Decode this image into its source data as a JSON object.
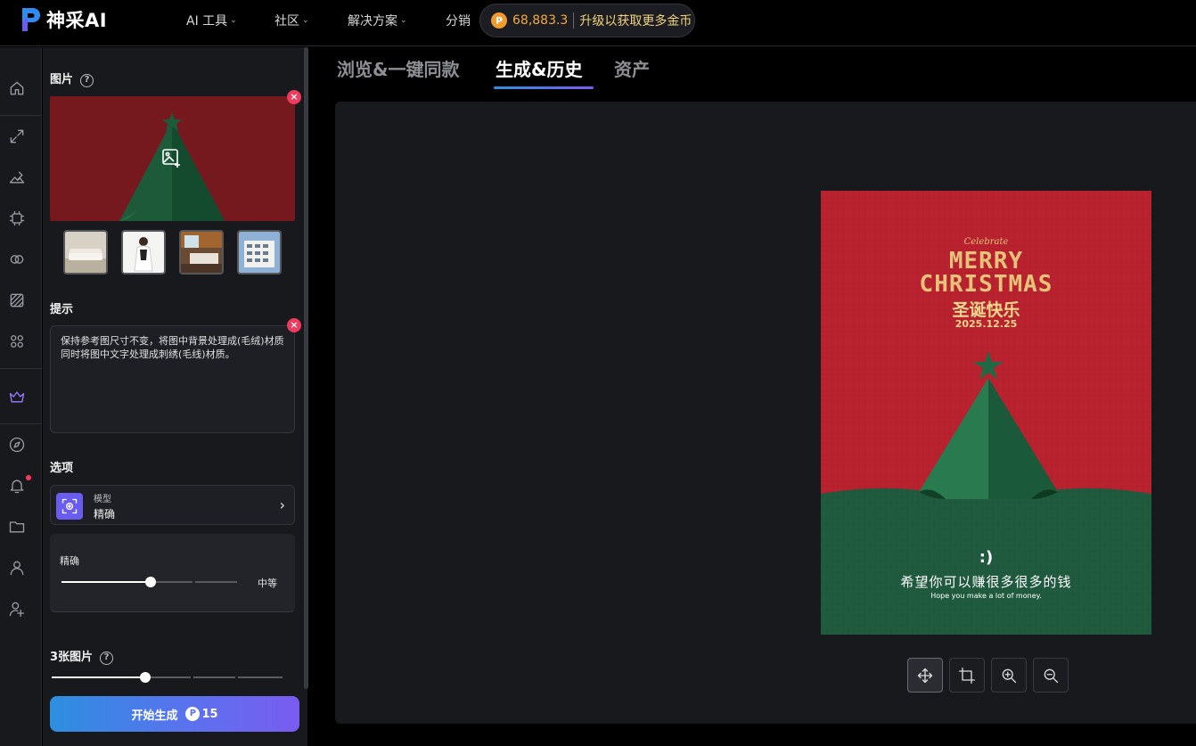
{
  "brand": {
    "name": "神采AI"
  },
  "nav": {
    "items": [
      {
        "label": "AI 工具",
        "has_menu": true
      },
      {
        "label": "社区",
        "has_menu": true
      },
      {
        "label": "解决方案",
        "has_menu": true
      },
      {
        "label": "分销",
        "has_menu": false
      }
    ],
    "coins": {
      "amount": "68,883.3",
      "upgrade": "升级以获取更多金币"
    }
  },
  "rail": {
    "icons": [
      "home-icon",
      "expand-icon",
      "edit-image-icon",
      "chip-icon",
      "link-icon",
      "texture-icon",
      "apps-icon",
      "crown-icon",
      "compass-icon",
      "bell-icon",
      "folder-icon",
      "user-icon",
      "user-settings-icon"
    ],
    "active": "crown-icon",
    "notification_dot": "bell-icon",
    "colors": {
      "active": "#9b7bff",
      "default": "#9a9ca3"
    }
  },
  "panel": {
    "image_section": {
      "title": "图片",
      "reference_thumbnails": [
        "sofa-thumbnail",
        "woman-in-white-thumbnail",
        "bedroom-thumbnail",
        "building-thumbnail"
      ]
    },
    "prompt_section": {
      "title": "提示",
      "text": "保持参考图尺寸不变，将图中背景处理成(毛绒)材质同时将图中文字处理成刺绣(毛线)材质。"
    },
    "options_section": {
      "title": "选项",
      "model": {
        "label": "模型",
        "value": "精确"
      },
      "precision": {
        "label": "精确",
        "value": "中等",
        "level": 0.5
      }
    },
    "count_section": {
      "title": "3张图片",
      "level": 0.5
    },
    "generate": {
      "label": "开始生成",
      "cost": "15"
    }
  },
  "main": {
    "tabs": [
      {
        "label": "浏览&一键同款",
        "active": false
      },
      {
        "label": "生成&历史",
        "active": true
      },
      {
        "label": "资产",
        "active": false
      }
    ],
    "poster": {
      "script_line": "Celebrate",
      "headline_1": "MERRY",
      "headline_2": "CHRISTMAS",
      "cn_title": "圣诞快乐",
      "date": "2025.12.25",
      "smiley": ":)",
      "cn_wish": "希望你可以赚很多很多的钱",
      "en_wish": "Hope you make a lot of money.",
      "colors": {
        "red": "#b8212e",
        "green": "#1f5a3f",
        "gold": "#e6c27a"
      }
    },
    "tools": [
      "move-icon",
      "crop-icon",
      "zoom-in-icon",
      "zoom-out-icon"
    ]
  }
}
